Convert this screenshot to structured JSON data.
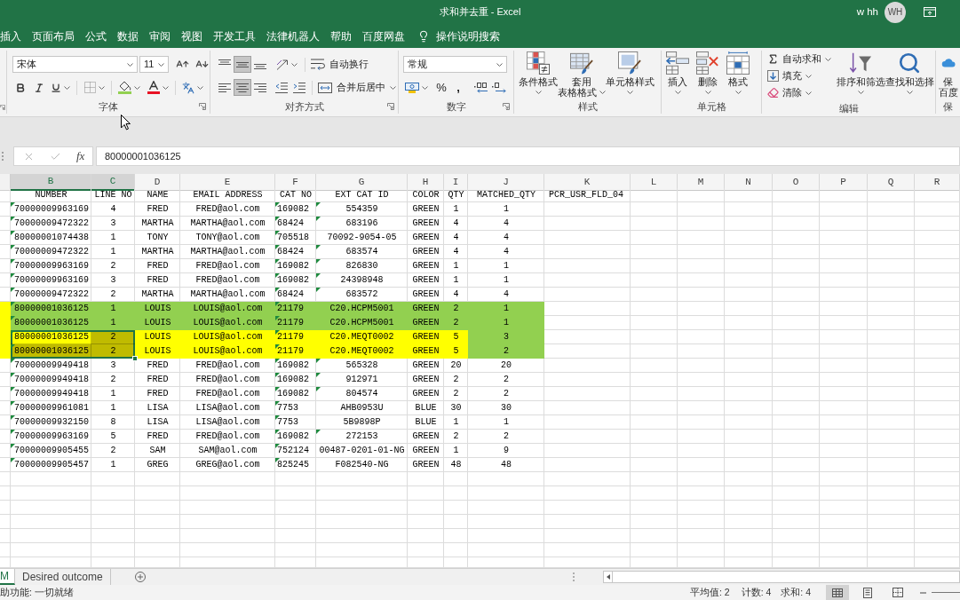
{
  "window": {
    "title": "求和并去重 - Excel",
    "user": "w hh",
    "avatar": "WH"
  },
  "menu_tabs": [
    "插入",
    "页面布局",
    "公式",
    "数据",
    "审阅",
    "视图",
    "开发工具",
    "法律机器人",
    "帮助",
    "百度网盘"
  ],
  "tell_me": {
    "label": "操作说明搜索"
  },
  "ribbon": {
    "font": {
      "label": "字体",
      "font_name": "宋体",
      "font_size": "11"
    },
    "alignment": {
      "label": "对齐方式",
      "vertical": [
        {
          "kind": "top",
          "pressed": false
        },
        {
          "kind": "middle",
          "pressed": true
        },
        {
          "kind": "bottom",
          "pressed": false
        }
      ],
      "horizontal": [
        {
          "kind": "left",
          "pressed": false
        },
        {
          "kind": "center",
          "pressed": true
        },
        {
          "kind": "right",
          "pressed": false
        }
      ],
      "wrap_text": "自动换行",
      "merge_center": "合并后居中"
    },
    "number": {
      "label": "数字",
      "format": "常规",
      "percent": "%",
      "comma": ","
    },
    "styles": {
      "label": "样式",
      "buttons": [
        {
          "kind": "conditional",
          "lines": [
            "条件格式"
          ]
        },
        {
          "kind": "table",
          "lines": [
            "套用",
            "表格格式"
          ]
        },
        {
          "kind": "cell_styles",
          "lines": [
            "单元格样式"
          ]
        }
      ]
    },
    "cells": {
      "label": "单元格",
      "buttons": [
        {
          "kind": "insert",
          "lines": [
            "插入"
          ]
        },
        {
          "kind": "delete",
          "lines": [
            "删除"
          ]
        },
        {
          "kind": "format",
          "lines": [
            "格式"
          ]
        }
      ]
    },
    "editing": {
      "label": "编辑",
      "small": [
        {
          "kind": "autosum",
          "label": "自动求和"
        },
        {
          "kind": "fill",
          "label": "填充"
        },
        {
          "kind": "clear",
          "label": "清除"
        }
      ],
      "buttons": [
        {
          "kind": "sort",
          "lines": [
            "排序和筛选"
          ]
        },
        {
          "kind": "find",
          "lines": [
            "查找和选择"
          ]
        }
      ]
    },
    "cut_group": {
      "label": "保",
      "button": {
        "kind": "cloud",
        "lines": [
          "保",
          "百度"
        ]
      }
    }
  },
  "formula_bar": {
    "function_label": "fx",
    "value": "80000001036125"
  },
  "sheet": {
    "columns": [
      {
        "letter": "B",
        "selected": true
      },
      {
        "letter": "C",
        "selected": true
      },
      {
        "letter": "D",
        "selected": false
      },
      {
        "letter": "E",
        "selected": false
      },
      {
        "letter": "F",
        "selected": false
      },
      {
        "letter": "G",
        "selected": false
      },
      {
        "letter": "H",
        "selected": false
      },
      {
        "letter": "I",
        "selected": false
      },
      {
        "letter": "J",
        "selected": false
      },
      {
        "letter": "K",
        "selected": false
      },
      {
        "letter": "L",
        "selected": false
      },
      {
        "letter": "M",
        "selected": false
      },
      {
        "letter": "N",
        "selected": false
      },
      {
        "letter": "O",
        "selected": false
      },
      {
        "letter": "P",
        "selected": false
      },
      {
        "letter": "Q",
        "selected": false
      },
      {
        "letter": "R",
        "selected": false
      }
    ],
    "rows": [
      {
        "cells": [
          {
            "text": "NUMBER",
            "flag": false,
            "selected": false
          },
          {
            "text": "LINE NO",
            "flag": false,
            "selected": false
          },
          {
            "text": "NAME",
            "flag": false,
            "selected": false
          },
          {
            "text": "EMAIL ADDRESS",
            "flag": false,
            "selected": false
          },
          {
            "text": "CAT NO",
            "flag": false,
            "selected": false
          },
          {
            "text": "EXT CAT ID",
            "flag": false,
            "selected": false
          },
          {
            "text": "COLOR",
            "flag": false,
            "selected": false
          },
          {
            "text": "QTY",
            "flag": false,
            "selected": false
          },
          {
            "text": "MATCHED_QTY",
            "flag": false,
            "selected": false
          },
          {
            "text": "PCR_USR_FLD_04",
            "flag": false,
            "selected": false
          }
        ]
      },
      {
        "cells": [
          {
            "text": "70000009963169",
            "flag": true,
            "selected": false
          },
          {
            "text": "4",
            "flag": false,
            "selected": false
          },
          {
            "text": "FRED",
            "flag": false,
            "selected": false
          },
          {
            "text": "FRED@aol.com",
            "flag": false,
            "selected": false
          },
          {
            "text": "169082",
            "flag": true,
            "selected": false
          },
          {
            "text": "554359",
            "flag": true,
            "selected": false
          },
          {
            "text": "GREEN",
            "flag": false,
            "selected": false
          },
          {
            "text": "1",
            "flag": false,
            "selected": false
          },
          {
            "text": "1",
            "flag": false,
            "selected": false
          }
        ]
      },
      {
        "cells": [
          {
            "text": "70000009472322",
            "flag": true,
            "selected": false
          },
          {
            "text": "3",
            "flag": false,
            "selected": false
          },
          {
            "text": "MARTHA",
            "flag": false,
            "selected": false
          },
          {
            "text": "MARTHA@aol.com",
            "flag": false,
            "selected": false
          },
          {
            "text": "68424",
            "flag": true,
            "selected": false
          },
          {
            "text": "683196",
            "flag": true,
            "selected": false
          },
          {
            "text": "GREEN",
            "flag": false,
            "selected": false
          },
          {
            "text": "4",
            "flag": false,
            "selected": false
          },
          {
            "text": "4",
            "flag": false,
            "selected": false
          }
        ]
      },
      {
        "cells": [
          {
            "text": "80000001074438",
            "flag": true,
            "selected": false
          },
          {
            "text": "1",
            "flag": false,
            "selected": false
          },
          {
            "text": "TONY",
            "flag": false,
            "selected": false
          },
          {
            "text": "TONY@aol.com",
            "flag": false,
            "selected": false
          },
          {
            "text": "705518",
            "flag": true,
            "selected": false
          },
          {
            "text": "70092-9054-05",
            "flag": false,
            "selected": false
          },
          {
            "text": "GREEN",
            "flag": false,
            "selected": false
          },
          {
            "text": "4",
            "flag": false,
            "selected": false
          },
          {
            "text": "4",
            "flag": false,
            "selected": false
          }
        ]
      },
      {
        "cells": [
          {
            "text": "70000009472322",
            "flag": true,
            "selected": false
          },
          {
            "text": "1",
            "flag": false,
            "selected": false
          },
          {
            "text": "MARTHA",
            "flag": false,
            "selected": false
          },
          {
            "text": "MARTHA@aol.com",
            "flag": false,
            "selected": false
          },
          {
            "text": "68424",
            "flag": true,
            "selected": false
          },
          {
            "text": "683574",
            "flag": true,
            "selected": false
          },
          {
            "text": "GREEN",
            "flag": false,
            "selected": false
          },
          {
            "text": "4",
            "flag": false,
            "selected": false
          },
          {
            "text": "4",
            "flag": false,
            "selected": false
          }
        ]
      },
      {
        "cells": [
          {
            "text": "70000009963169",
            "flag": true,
            "selected": false
          },
          {
            "text": "2",
            "flag": false,
            "selected": false
          },
          {
            "text": "FRED",
            "flag": false,
            "selected": false
          },
          {
            "text": "FRED@aol.com",
            "flag": false,
            "selected": false
          },
          {
            "text": "169082",
            "flag": true,
            "selected": false
          },
          {
            "text": "826830",
            "flag": true,
            "selected": false
          },
          {
            "text": "GREEN",
            "flag": false,
            "selected": false
          },
          {
            "text": "1",
            "flag": false,
            "selected": false
          },
          {
            "text": "1",
            "flag": false,
            "selected": false
          }
        ]
      },
      {
        "cells": [
          {
            "text": "70000009963169",
            "flag": true,
            "selected": false
          },
          {
            "text": "3",
            "flag": false,
            "selected": false
          },
          {
            "text": "FRED",
            "flag": false,
            "selected": false
          },
          {
            "text": "FRED@aol.com",
            "flag": false,
            "selected": false
          },
          {
            "text": "169082",
            "flag": true,
            "selected": false
          },
          {
            "text": "24398948",
            "flag": true,
            "selected": false
          },
          {
            "text": "GREEN",
            "flag": false,
            "selected": false
          },
          {
            "text": "1",
            "flag": false,
            "selected": false
          },
          {
            "text": "1",
            "flag": false,
            "selected": false
          }
        ]
      },
      {
        "cells": [
          {
            "text": "70000009472322",
            "flag": true,
            "selected": false
          },
          {
            "text": "2",
            "flag": false,
            "selected": false
          },
          {
            "text": "MARTHA",
            "flag": false,
            "selected": false
          },
          {
            "text": "MARTHA@aol.com",
            "flag": false,
            "selected": false
          },
          {
            "text": "68424",
            "flag": true,
            "selected": false
          },
          {
            "text": "683572",
            "flag": true,
            "selected": false
          },
          {
            "text": "GREEN",
            "flag": false,
            "selected": false
          },
          {
            "text": "4",
            "flag": false,
            "selected": false
          },
          {
            "text": "4",
            "flag": false,
            "selected": false
          }
        ]
      },
      {
        "column_a": {
          "color": "#ffff00"
        },
        "cells": [
          {
            "text": "80000001036125",
            "flag": true,
            "selected": false,
            "color": "#92d050"
          },
          {
            "text": "1",
            "flag": false,
            "selected": false,
            "color": "#92d050"
          },
          {
            "text": "LOUIS",
            "flag": false,
            "selected": false,
            "color": "#92d050"
          },
          {
            "text": "LOUIS@aol.com",
            "flag": false,
            "selected": false,
            "color": "#92d050"
          },
          {
            "text": "21179",
            "flag": true,
            "selected": false,
            "color": "#92d050"
          },
          {
            "text": "C20.HCPM5001",
            "flag": false,
            "selected": false,
            "color": "#92d050"
          },
          {
            "text": "GREEN",
            "flag": false,
            "selected": false,
            "color": "#92d050"
          },
          {
            "text": "2",
            "flag": false,
            "selected": false,
            "color": "#92d050"
          },
          {
            "text": "1",
            "flag": false,
            "selected": false,
            "color": "#92d050"
          }
        ]
      },
      {
        "column_a": {
          "color": "#ffff00"
        },
        "cells": [
          {
            "text": "80000001036125",
            "flag": true,
            "selected": false,
            "color": "#92d050"
          },
          {
            "text": "1",
            "flag": false,
            "selected": false,
            "color": "#92d050"
          },
          {
            "text": "LOUIS",
            "flag": false,
            "selected": false,
            "color": "#92d050"
          },
          {
            "text": "LOUIS@aol.com",
            "flag": false,
            "selected": false,
            "color": "#92d050"
          },
          {
            "text": "21179",
            "flag": true,
            "selected": false,
            "color": "#92d050"
          },
          {
            "text": "C20.HCPM5001",
            "flag": false,
            "selected": false,
            "color": "#92d050"
          },
          {
            "text": "GREEN",
            "flag": false,
            "selected": false,
            "color": "#92d050"
          },
          {
            "text": "2",
            "flag": false,
            "selected": false,
            "color": "#92d050"
          },
          {
            "text": "1",
            "flag": false,
            "selected": false,
            "color": "#92d050"
          }
        ]
      },
      {
        "column_a": {
          "color": "#ffff00"
        },
        "cells": [
          {
            "text": "80000001036125",
            "flag": true,
            "selected": true,
            "color": "#ffff00"
          },
          {
            "text": "2",
            "flag": false,
            "selected": true,
            "color": "#c0bb00"
          },
          {
            "text": "LOUIS",
            "flag": false,
            "selected": false,
            "color": "#ffff00"
          },
          {
            "text": "LOUIS@aol.com",
            "flag": false,
            "selected": false,
            "color": "#ffff00"
          },
          {
            "text": "21179",
            "flag": true,
            "selected": false,
            "color": "#ffff00"
          },
          {
            "text": "C20.MEQT0002",
            "flag": false,
            "selected": false,
            "color": "#ffff00"
          },
          {
            "text": "GREEN",
            "flag": false,
            "selected": false,
            "color": "#ffff00"
          },
          {
            "text": "5",
            "flag": false,
            "selected": false,
            "color": "#ffff00"
          },
          {
            "text": "3",
            "flag": false,
            "selected": false,
            "color": "#92d050"
          }
        ]
      },
      {
        "column_a": {
          "color": "#ffff00"
        },
        "cells": [
          {
            "text": "80000001036125",
            "flag": true,
            "selected": true,
            "color": "#c0bb00"
          },
          {
            "text": "2",
            "flag": false,
            "selected": true,
            "color": "#c0bb00"
          },
          {
            "text": "LOUIS",
            "flag": false,
            "selected": false,
            "color": "#ffff00"
          },
          {
            "text": "LOUIS@aol.com",
            "flag": false,
            "selected": false,
            "color": "#ffff00"
          },
          {
            "text": "21179",
            "flag": true,
            "selected": false,
            "color": "#ffff00"
          },
          {
            "text": "C20.MEQT0002",
            "flag": false,
            "selected": false,
            "color": "#ffff00"
          },
          {
            "text": "GREEN",
            "flag": false,
            "selected": false,
            "color": "#ffff00"
          },
          {
            "text": "5",
            "flag": false,
            "selected": false,
            "color": "#ffff00"
          },
          {
            "text": "2",
            "flag": false,
            "selected": false,
            "color": "#92d050"
          }
        ]
      },
      {
        "cells": [
          {
            "text": "70000009949418",
            "flag": true,
            "selected": false
          },
          {
            "text": "3",
            "flag": false,
            "selected": false
          },
          {
            "text": "FRED",
            "flag": false,
            "selected": false
          },
          {
            "text": "FRED@aol.com",
            "flag": false,
            "selected": false
          },
          {
            "text": "169082",
            "flag": true,
            "selected": false
          },
          {
            "text": "565328",
            "flag": true,
            "selected": false
          },
          {
            "text": "GREEN",
            "flag": false,
            "selected": false
          },
          {
            "text": "20",
            "flag": false,
            "selected": false
          },
          {
            "text": "20",
            "flag": false,
            "selected": false
          }
        ]
      },
      {
        "cells": [
          {
            "text": "70000009949418",
            "flag": true,
            "selected": false
          },
          {
            "text": "2",
            "flag": false,
            "selected": false
          },
          {
            "text": "FRED",
            "flag": false,
            "selected": false
          },
          {
            "text": "FRED@aol.com",
            "flag": false,
            "selected": false
          },
          {
            "text": "169082",
            "flag": true,
            "selected": false
          },
          {
            "text": "912971",
            "flag": true,
            "selected": false
          },
          {
            "text": "GREEN",
            "flag": false,
            "selected": false
          },
          {
            "text": "2",
            "flag": false,
            "selected": false
          },
          {
            "text": "2",
            "flag": false,
            "selected": false
          }
        ]
      },
      {
        "cells": [
          {
            "text": "70000009949418",
            "flag": true,
            "selected": false
          },
          {
            "text": "1",
            "flag": false,
            "selected": false
          },
          {
            "text": "FRED",
            "flag": false,
            "selected": false
          },
          {
            "text": "FRED@aol.com",
            "flag": false,
            "selected": false
          },
          {
            "text": "169082",
            "flag": true,
            "selected": false
          },
          {
            "text": "804574",
            "flag": true,
            "selected": false
          },
          {
            "text": "GREEN",
            "flag": false,
            "selected": false
          },
          {
            "text": "2",
            "flag": false,
            "selected": false
          },
          {
            "text": "2",
            "flag": false,
            "selected": false
          }
        ]
      },
      {
        "cells": [
          {
            "text": "70000009961081",
            "flag": true,
            "selected": false
          },
          {
            "text": "1",
            "flag": false,
            "selected": false
          },
          {
            "text": "LISA",
            "flag": false,
            "selected": false
          },
          {
            "text": "LISA@aol.com",
            "flag": false,
            "selected": false
          },
          {
            "text": "7753",
            "flag": true,
            "selected": false
          },
          {
            "text": "AHB0953U",
            "flag": false,
            "selected": false
          },
          {
            "text": "BLUE",
            "flag": false,
            "selected": false
          },
          {
            "text": "30",
            "flag": false,
            "selected": false
          },
          {
            "text": "30",
            "flag": false,
            "selected": false
          }
        ]
      },
      {
        "cells": [
          {
            "text": "70000009932150",
            "flag": true,
            "selected": false
          },
          {
            "text": "8",
            "flag": false,
            "selected": false
          },
          {
            "text": "LISA",
            "flag": false,
            "selected": false
          },
          {
            "text": "LISA@aol.com",
            "flag": false,
            "selected": false
          },
          {
            "text": "7753",
            "flag": true,
            "selected": false
          },
          {
            "text": "5B9898P",
            "flag": false,
            "selected": false
          },
          {
            "text": "BLUE",
            "flag": false,
            "selected": false
          },
          {
            "text": "1",
            "flag": false,
            "selected": false
          },
          {
            "text": "1",
            "flag": false,
            "selected": false
          }
        ]
      },
      {
        "cells": [
          {
            "text": "70000009963169",
            "flag": true,
            "selected": false
          },
          {
            "text": "5",
            "flag": false,
            "selected": false
          },
          {
            "text": "FRED",
            "flag": false,
            "selected": false
          },
          {
            "text": "FRED@aol.com",
            "flag": false,
            "selected": false
          },
          {
            "text": "169082",
            "flag": true,
            "selected": false
          },
          {
            "text": "272153",
            "flag": true,
            "selected": false
          },
          {
            "text": "GREEN",
            "flag": false,
            "selected": false
          },
          {
            "text": "2",
            "flag": false,
            "selected": false
          },
          {
            "text": "2",
            "flag": false,
            "selected": false
          }
        ]
      },
      {
        "cells": [
          {
            "text": "70000009905455",
            "flag": true,
            "selected": false
          },
          {
            "text": "2",
            "flag": false,
            "selected": false
          },
          {
            "text": "SAM",
            "flag": false,
            "selected": false
          },
          {
            "text": "SAM@aol.com",
            "flag": false,
            "selected": false
          },
          {
            "text": "752124",
            "flag": true,
            "selected": false
          },
          {
            "text": "00487-0201-01-NG",
            "flag": false,
            "selected": false
          },
          {
            "text": "GREEN",
            "flag": false,
            "selected": false
          },
          {
            "text": "1",
            "flag": false,
            "selected": false
          },
          {
            "text": "9",
            "flag": false,
            "selected": false
          }
        ]
      },
      {
        "cells": [
          {
            "text": "70000009905457",
            "flag": true,
            "selected": false
          },
          {
            "text": "1",
            "flag": false,
            "selected": false
          },
          {
            "text": "GREG",
            "flag": false,
            "selected": false
          },
          {
            "text": "GREG@aol.com",
            "flag": false,
            "selected": false
          },
          {
            "text": "825245",
            "flag": true,
            "selected": false
          },
          {
            "text": "F082540-NG",
            "flag": false,
            "selected": false
          },
          {
            "text": "GREEN",
            "flag": false,
            "selected": false
          },
          {
            "text": "48",
            "flag": false,
            "selected": false
          },
          {
            "text": "48",
            "flag": false,
            "selected": false
          }
        ]
      }
    ]
  },
  "sheet_tabs": [
    {
      "label": "M",
      "selected": true
    },
    {
      "label": "Desired outcome",
      "selected": false
    }
  ],
  "status_bar": {
    "message": "助功能: 一切就绪",
    "average": "平均值: 2",
    "count": "计数: 4",
    "sum": "求和: 4",
    "views": [
      {
        "kind": "normal",
        "selected": true
      },
      {
        "kind": "page_layout",
        "selected": false
      },
      {
        "kind": "page_break",
        "selected": false
      }
    ]
  }
}
